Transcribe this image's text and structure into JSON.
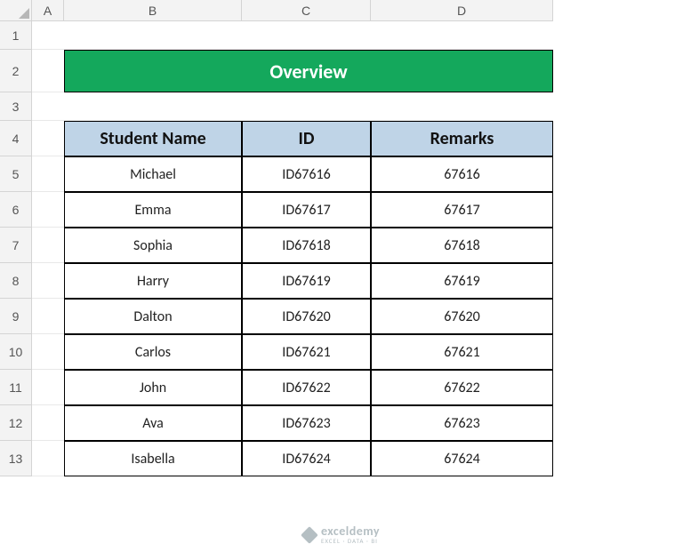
{
  "columns": [
    "A",
    "B",
    "C",
    "D"
  ],
  "rows": [
    "1",
    "2",
    "3",
    "4",
    "5",
    "6",
    "7",
    "8",
    "9",
    "10",
    "11",
    "12",
    "13"
  ],
  "title": "Overview",
  "headers": {
    "name": "Student Name",
    "id": "ID",
    "remarks": "Remarks"
  },
  "data": [
    {
      "name": "Michael",
      "id": "ID67616",
      "remarks": "67616"
    },
    {
      "name": "Emma",
      "id": "ID67617",
      "remarks": "67617"
    },
    {
      "name": "Sophia",
      "id": "ID67618",
      "remarks": "67618"
    },
    {
      "name": "Harry",
      "id": "ID67619",
      "remarks": "67619"
    },
    {
      "name": "Dalton",
      "id": "ID67620",
      "remarks": "67620"
    },
    {
      "name": "Carlos",
      "id": "ID67621",
      "remarks": "67621"
    },
    {
      "name": "John",
      "id": "ID67622",
      "remarks": "67622"
    },
    {
      "name": "Ava",
      "id": "ID67623",
      "remarks": "67623"
    },
    {
      "name": "Isabella",
      "id": "ID67624",
      "remarks": "67624"
    }
  ],
  "watermark": {
    "brand": "exceldemy",
    "sub": "EXCEL · DATA · BI"
  },
  "chart_data": {
    "type": "table",
    "title": "Overview",
    "columns": [
      "Student Name",
      "ID",
      "Remarks"
    ],
    "rows": [
      [
        "Michael",
        "ID67616",
        "67616"
      ],
      [
        "Emma",
        "ID67617",
        "67617"
      ],
      [
        "Sophia",
        "ID67618",
        "67618"
      ],
      [
        "Harry",
        "ID67619",
        "67619"
      ],
      [
        "Dalton",
        "ID67620",
        "67620"
      ],
      [
        "Carlos",
        "ID67621",
        "67621"
      ],
      [
        "John",
        "ID67622",
        "67622"
      ],
      [
        "Ava",
        "ID67623",
        "67623"
      ],
      [
        "Isabella",
        "ID67624",
        "67624"
      ]
    ]
  }
}
